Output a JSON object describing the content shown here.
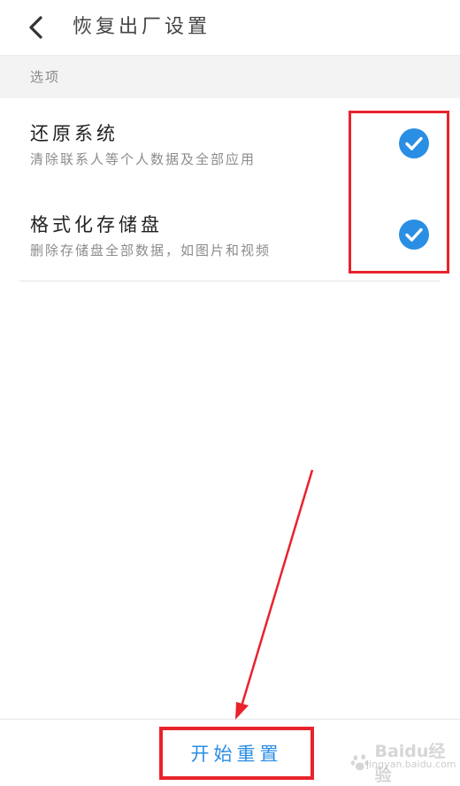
{
  "header": {
    "back_icon": "chevron-left-icon",
    "title": "恢复出厂设置"
  },
  "section": {
    "label": "选项"
  },
  "options": [
    {
      "title": "还原系统",
      "description": "清除联系人等个人数据及全部应用",
      "checked": true
    },
    {
      "title": "格式化存储盘",
      "description": "删除存储盘全部数据，如图片和视频",
      "checked": true
    }
  ],
  "footer": {
    "start_reset_label": "开始重置"
  },
  "watermark": {
    "text": "Baidu经验",
    "sub": "jingyan.baidu.com"
  },
  "colors": {
    "accent_blue": "#2a8ee4",
    "highlight_red": "#e8232b",
    "section_bg": "#f3f3f3"
  }
}
